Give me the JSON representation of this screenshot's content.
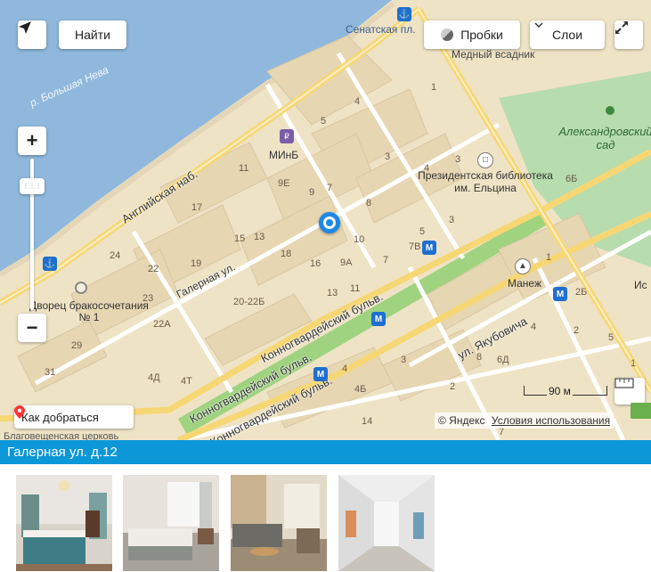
{
  "map": {
    "controls": {
      "find_label": "Найти",
      "traffic_label": "Пробки",
      "layers_label": "Слои",
      "zoom_in": "+",
      "zoom_out": "−",
      "directions_label": "Как добраться"
    },
    "labels": {
      "river": "р. Большая Нева",
      "senate": "Сенатская пл.",
      "bronze_horseman": "Медный всадник",
      "garden": "Александровский сад",
      "library": "Президентская библиотека им. Ельцина",
      "minb": "МИнБ",
      "manezh": "Манеж",
      "palace": "Дворец бракосочетания № 1",
      "church": "Благовещенская церковь",
      "io": "Ис",
      "angliyskaya": "Английская наб.",
      "galernaya": "Галерная ул.",
      "konnogv1": "Конногвардейский бульв.",
      "konnogv2": "Конногвардейский бульв.",
      "konnogv3": "Конногвардейский бульв.",
      "yakubovicha": "ул. Якубовича"
    },
    "house_numbers": [
      "1",
      "5",
      "4",
      "3",
      "11",
      "9Е",
      "9",
      "7",
      "4",
      "3",
      "6Б",
      "17",
      "8",
      "5",
      "3",
      "15",
      "13",
      "10",
      "7В",
      "24",
      "22",
      "19",
      "18",
      "16",
      "9А",
      "7",
      "1",
      "2Б",
      "23",
      "20-22Б",
      "13",
      "11",
      "22А",
      "5",
      "4",
      "29",
      "31",
      "3",
      "8",
      "6Д",
      "2",
      "1",
      "4Д",
      "4Т",
      "4",
      "4Б",
      "2",
      "14",
      "7"
    ],
    "scale_label": "90 м",
    "copyright": "© Яндекс",
    "terms_link": "Условия использования"
  },
  "listing": {
    "address": "Галерная ул. д.12",
    "photos": [
      {
        "name": "bedroom-photo-1"
      },
      {
        "name": "bedroom-photo-2"
      },
      {
        "name": "living-room-photo"
      },
      {
        "name": "hallway-photo"
      }
    ]
  },
  "colors": {
    "land": "#efe3c6",
    "water": "#8fb8dc",
    "park": "#b7dcae",
    "road": "#ffffff",
    "major_road": "#f7d774",
    "boulevard": "#9fd37f",
    "marker": "#1e88e5",
    "title_bar": "#0b97d8"
  }
}
